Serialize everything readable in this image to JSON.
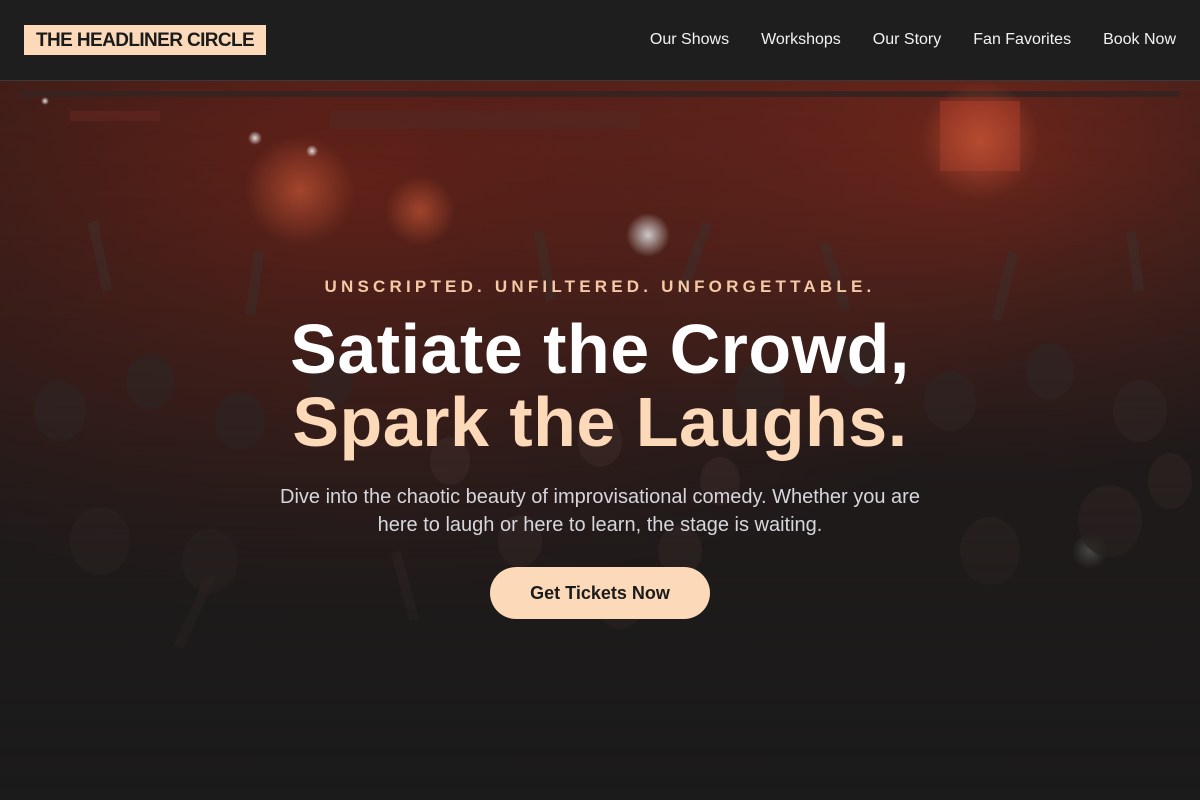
{
  "brand": {
    "logo_text": "THE HEADLINER CIRCLE"
  },
  "nav": {
    "items": [
      {
        "label": "Our Shows"
      },
      {
        "label": "Workshops"
      },
      {
        "label": "Our Story"
      },
      {
        "label": "Fan Favorites"
      },
      {
        "label": "Book Now"
      }
    ]
  },
  "hero": {
    "tagline": "UNSCRIPTED. UNFILTERED. UNFORGETTABLE.",
    "headline_line1": "Satiate the Crowd,",
    "headline_line2": "Spark the Laughs.",
    "subtext": "Dive into the chaotic beauty of improvisational comedy. Whether you are here to laugh or here to learn, the stage is waiting.",
    "cta_label": "Get Tickets Now"
  },
  "colors": {
    "accent": "#fcd9b8",
    "tagline": "#f5c9a6",
    "background": "#1b1b1b",
    "nav_background": "#1e1e1e"
  }
}
